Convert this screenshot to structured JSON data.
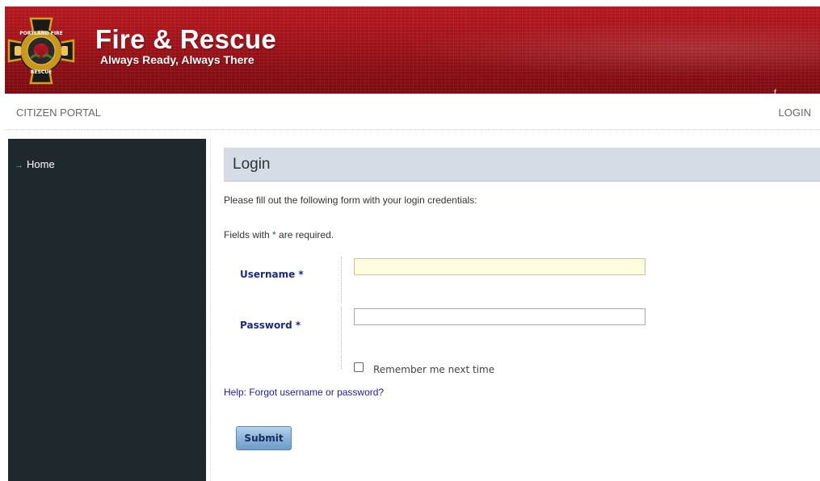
{
  "header": {
    "title": "Fire & Rescue",
    "subtitle": "Always Ready, Always There",
    "logo": {
      "text_top": "PORTLAND FIRE",
      "text_bottom": "RESCUE",
      "icon": "maltese-cross-rose-emblem"
    },
    "mark": "f"
  },
  "topnav": {
    "portal_label": "CITIZEN PORTAL",
    "login_label": "LOGIN"
  },
  "sidebar": {
    "items": [
      {
        "label": "Home",
        "icon": "arrow-right-icon"
      }
    ]
  },
  "main": {
    "heading": "Login",
    "intro": "Please fill out the following form with your login credentials:",
    "required_note": {
      "prefix": "Fields with ",
      "star": "*",
      "suffix": " are required."
    },
    "form": {
      "username_label": "Username *",
      "username_value": "",
      "password_label": "Password *",
      "password_value": "",
      "remember_label": "Remember me next time",
      "remember_checked": false
    },
    "help_link": "Help: Forgot username or password?",
    "submit_label": "Submit"
  },
  "colors": {
    "header_red": "#a4141a",
    "sidebar_bg": "#1f282c",
    "heading_bar": "#d5dce6",
    "label_navy": "#1c2a86",
    "link_blue": "#1a1aa6",
    "username_bg": "#fffcdf",
    "button_blue": "#8cb4dc"
  }
}
